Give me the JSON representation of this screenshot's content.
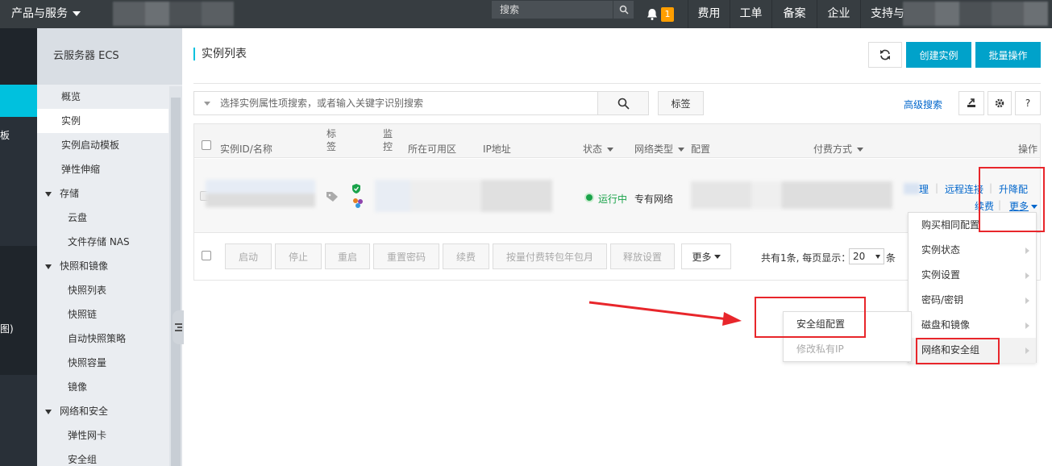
{
  "topbar": {
    "product_menu": "产品与服务",
    "search_placeholder": "搜索",
    "notification_count": "1",
    "nav": [
      "费用",
      "工单",
      "备案",
      "企业",
      "支持与服务"
    ]
  },
  "left_rail": {
    "label1": "板",
    "label2": "图)"
  },
  "sidebar": {
    "title": "云服务器 ECS",
    "items": [
      {
        "label": "概览"
      },
      {
        "label": "实例"
      },
      {
        "label": "实例启动模板"
      },
      {
        "label": "弹性伸缩"
      },
      {
        "label": "存储"
      },
      {
        "label": "云盘"
      },
      {
        "label": "文件存储 NAS"
      },
      {
        "label": "快照和镜像"
      },
      {
        "label": "快照列表"
      },
      {
        "label": "快照链"
      },
      {
        "label": "自动快照策略"
      },
      {
        "label": "快照容量"
      },
      {
        "label": "镜像"
      },
      {
        "label": "网络和安全"
      },
      {
        "label": "弹性网卡"
      },
      {
        "label": "安全组"
      }
    ]
  },
  "page": {
    "title": "实例列表",
    "create_button": "创建实例",
    "batch_button": "批量操作",
    "search_placeholder": "选择实例属性项搜索，或者输入关键字识别搜索",
    "tag_button": "标签",
    "advanced_search": "高级搜索"
  },
  "table": {
    "headers": {
      "id_name": "实例ID/名称",
      "tag": "标签",
      "monitor": "监控",
      "zone": "所在可用区",
      "ip": "IP地址",
      "status": "状态",
      "network": "网络类型",
      "config": "配置",
      "billing": "付费方式",
      "actions": "操作"
    },
    "row": {
      "status": "运行中",
      "network": "专有网络",
      "action_manage_partial": "理",
      "action_remote": "远程连接",
      "action_upgrade": "升降配",
      "action_renew": "续费",
      "action_more": "更多"
    },
    "bottom_buttons": [
      "启动",
      "停止",
      "重启",
      "重置密码",
      "续费",
      "按量付费转包年包月",
      "释放设置"
    ],
    "bottom_more": "更多",
    "pager_text": "共有1条, 每页显示：",
    "page_size": "20",
    "pager_unit": "条"
  },
  "more_menu": {
    "items": [
      "购买相同配置",
      "实例状态",
      "实例设置",
      "密码/密钥",
      "磁盘和镜像",
      "网络和安全组"
    ]
  },
  "sub_menu": {
    "items": [
      "安全组配置",
      "修改私有IP"
    ]
  },
  "colors": {
    "accent": "#00c1de",
    "button_blue": "#00a2ca",
    "highlight": "#e8262b",
    "topbar": "#373d41"
  }
}
